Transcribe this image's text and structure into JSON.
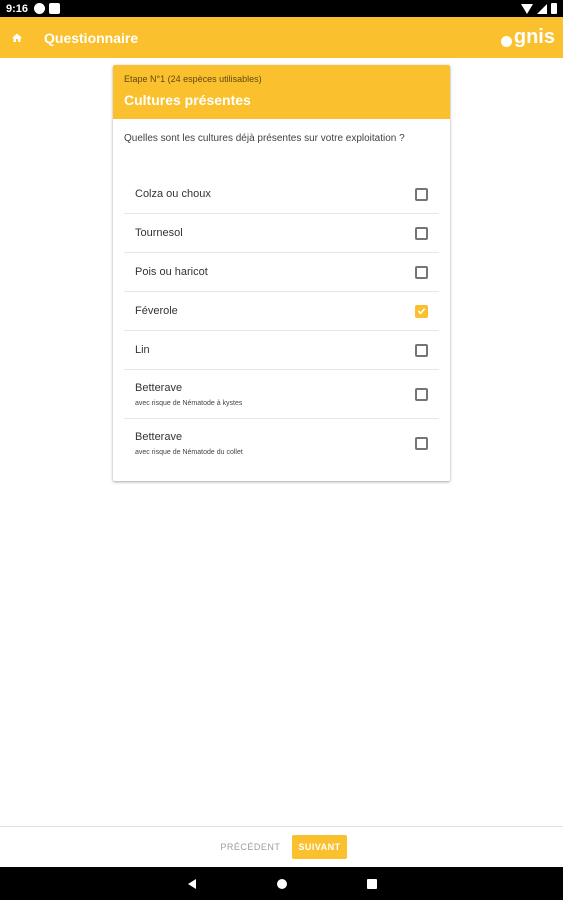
{
  "status_bar": {
    "time": "9:16"
  },
  "app_bar": {
    "title": "Questionnaire",
    "logo_text": "gnis"
  },
  "card": {
    "step": "Etape N°1 (24 espèces utilisables)",
    "heading": "Cultures présentes",
    "question": "Quelles sont les cultures déjà présentes sur votre exploitation ?"
  },
  "options": [
    {
      "label": "Colza ou choux",
      "sub": "",
      "checked": false
    },
    {
      "label": "Tournesol",
      "sub": "",
      "checked": false
    },
    {
      "label": "Pois ou haricot",
      "sub": "",
      "checked": false
    },
    {
      "label": "Féverole",
      "sub": "",
      "checked": true
    },
    {
      "label": "Lin",
      "sub": "",
      "checked": false
    },
    {
      "label": "Betterave",
      "sub": "avec risque de Nématode à kystes",
      "checked": false
    },
    {
      "label": "Betterave",
      "sub": "avec risque de Nématode du collet",
      "checked": false
    }
  ],
  "footer": {
    "prev_label": "PRÉCÉDENT",
    "next_label": "SUIVANT"
  },
  "colors": {
    "accent": "#fbc02d"
  },
  "icons": {
    "home": "home-icon",
    "back": "back-icon",
    "home_nav": "home-nav-icon",
    "recents": "recents-icon"
  }
}
